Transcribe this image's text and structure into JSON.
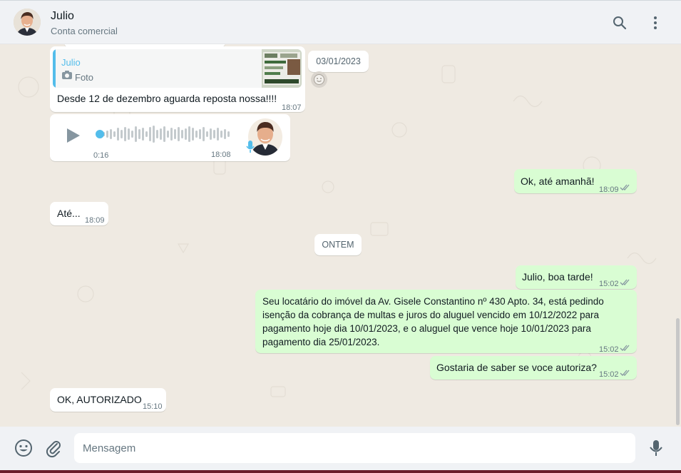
{
  "header": {
    "contact_name": "Julio",
    "contact_subtitle": "Conta comercial",
    "search_icon": "search-icon",
    "menu_icon": "kebab-menu-icon"
  },
  "messages": {
    "reply": {
      "quote_author": "Julio",
      "quote_type": "Foto",
      "text": "Desde 12 de dezembro aguarda reposta nossa!!!!",
      "time": "18:07"
    },
    "date_chip_1": "03/01/2023",
    "voice": {
      "duration": "0:16",
      "time": "18:08",
      "progress": 0.0
    },
    "out_1": {
      "text": "Ok, até amanhã!",
      "time": "18:09"
    },
    "in_1": {
      "text": "Até...",
      "time": "18:09"
    },
    "date_chip_2": "ONTEM",
    "out_2": {
      "text": "Julio, boa tarde!",
      "time": "15:02"
    },
    "out_3": {
      "line1": "Seu locatário do imóvel da Av. Gisele Constantino nº 430 Apto. 34, está pedindo",
      "line2": "isenção da cobrança de multas e juros do aluguel vencido em 10/12/2022 para",
      "line3": "pagamento hoje dia 10/01/2023, e o aluguel que vence hoje 10/01/2023 para",
      "line4": "pagamento dia 25/01/2023.",
      "time": "15:02"
    },
    "out_4": {
      "text": "Gostaria de saber se voce autoriza?",
      "time": "15:02"
    },
    "in_2": {
      "text": "OK, AUTORIZADO",
      "time": "15:10"
    }
  },
  "footer": {
    "placeholder": "Mensagem",
    "value": "",
    "emoji_icon": "emoji-icon",
    "attach_icon": "paperclip-icon",
    "mic_icon": "microphone-icon"
  },
  "colors": {
    "outgoing_bubble": "#d9fdd3",
    "incoming_bubble": "#ffffff",
    "chat_background": "#efeae2",
    "read_ticks": "#8696a0",
    "voice_accent": "#53bdeb",
    "quote_bar": "#53bdeb"
  }
}
